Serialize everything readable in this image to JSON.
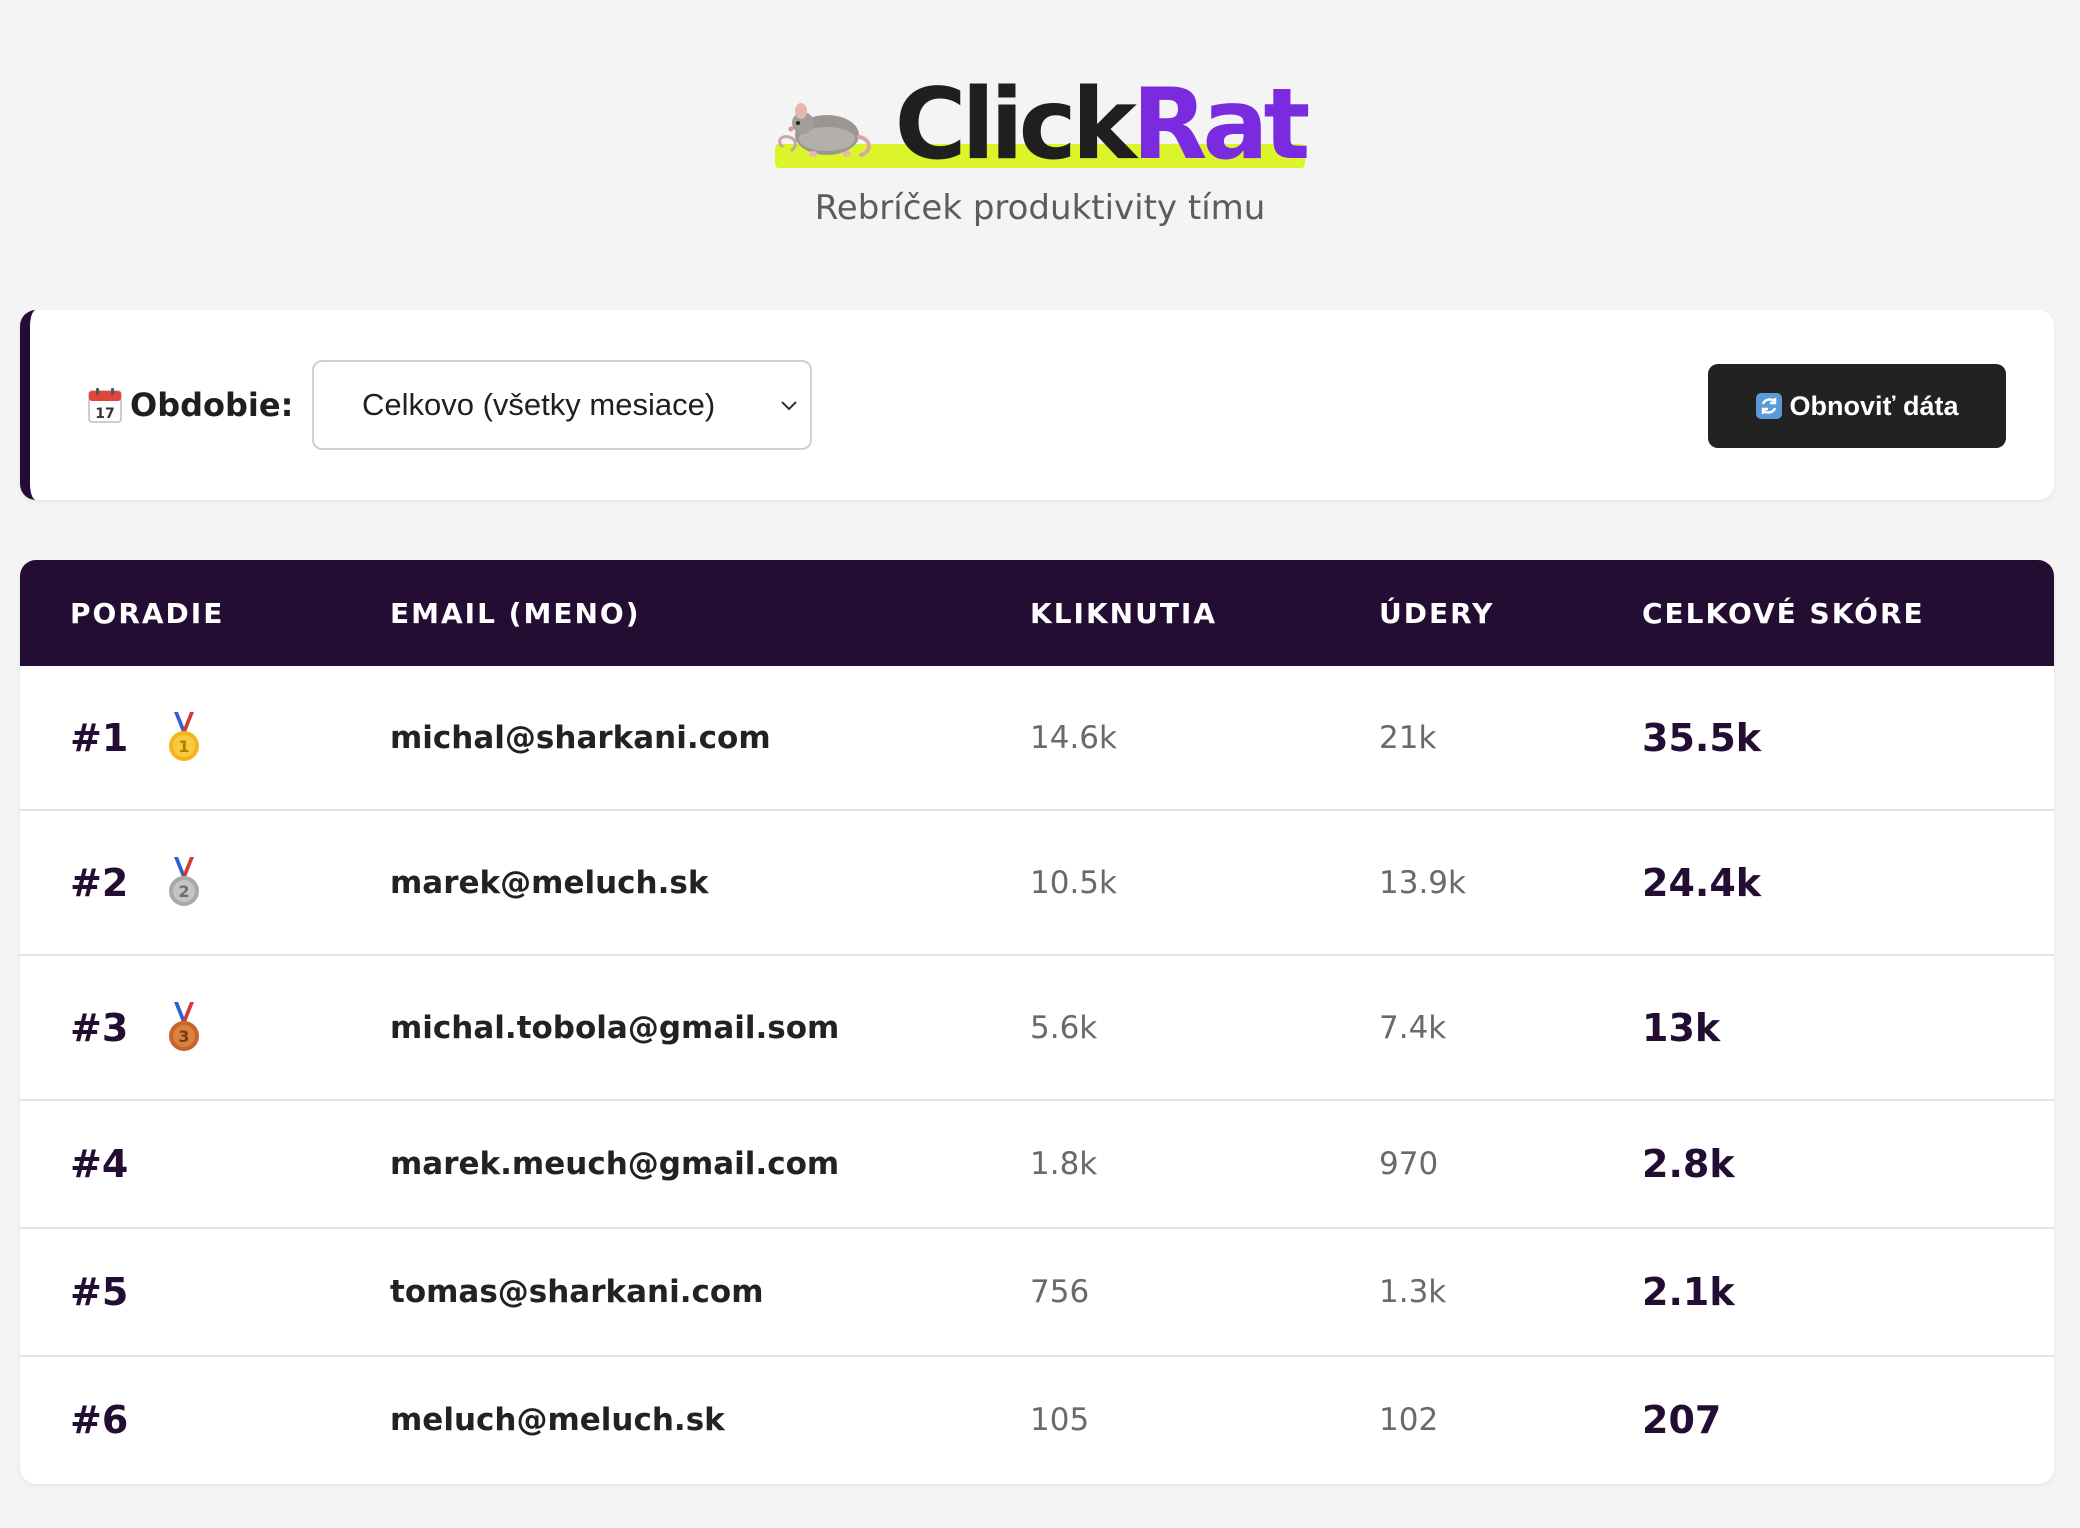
{
  "header": {
    "brand_part1": "Click",
    "brand_part2": "Rat",
    "subtitle": "Rebríček produktivity tímu"
  },
  "filter": {
    "label": "Obdobie:",
    "selected": "Celkovo (všetky mesiace)",
    "refresh_label": "Obnoviť dáta"
  },
  "table": {
    "columns": [
      "PORADIE",
      "EMAIL (MENO)",
      "KLIKNUTIA",
      "ÚDERY",
      "CELKOVÉ SKÓRE"
    ],
    "rows": [
      {
        "rank": "#1",
        "medal": "gold-medal-icon",
        "email": "michal@sharkani.com",
        "clicks": "14.6k",
        "keys": "21k",
        "score": "35.5k"
      },
      {
        "rank": "#2",
        "medal": "silver-medal-icon",
        "email": "marek@meluch.sk",
        "clicks": "10.5k",
        "keys": "13.9k",
        "score": "24.4k"
      },
      {
        "rank": "#3",
        "medal": "bronze-medal-icon",
        "email": "michal.tobola@gmail.som",
        "clicks": "5.6k",
        "keys": "7.4k",
        "score": "13k"
      },
      {
        "rank": "#4",
        "medal": "",
        "email": "marek.meuch@gmail.com",
        "clicks": "1.8k",
        "keys": "970",
        "score": "2.8k"
      },
      {
        "rank": "#5",
        "medal": "",
        "email": "tomas@sharkani.com",
        "clicks": "756",
        "keys": "1.3k",
        "score": "2.1k"
      },
      {
        "rank": "#6",
        "medal": "",
        "email": "meluch@meluch.sk",
        "clicks": "105",
        "keys": "102",
        "score": "207"
      }
    ]
  },
  "colors": {
    "accent": "#7a2be0",
    "highlight": "#dcf52a",
    "header_bg": "#230d33",
    "gold": "#f2b51f",
    "silver": "#a9a9a9",
    "bronze": "#c2672a"
  }
}
